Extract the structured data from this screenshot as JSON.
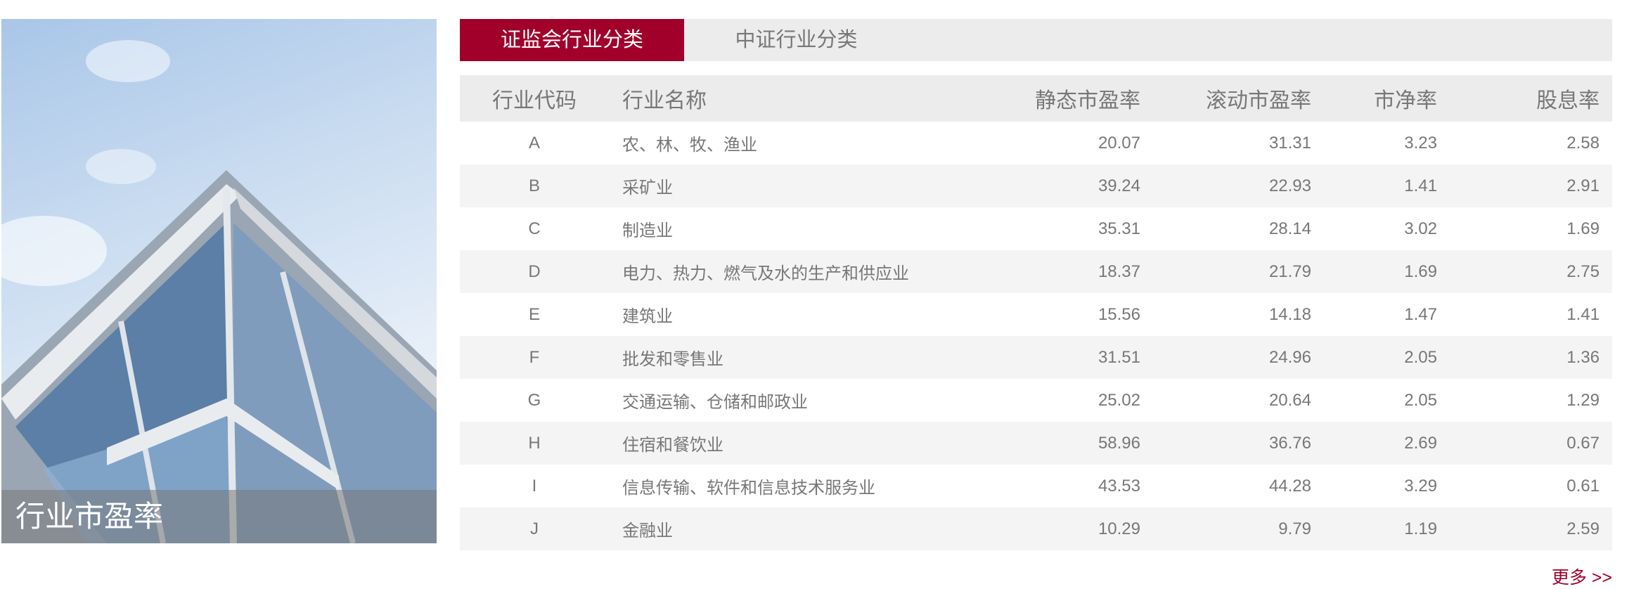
{
  "hero": {
    "caption": "行业市盈率"
  },
  "tabs": [
    {
      "label": "证监会行业分类",
      "active": true
    },
    {
      "label": "中证行业分类",
      "active": false
    }
  ],
  "table": {
    "headers": [
      "行业代码",
      "行业名称",
      "静态市盈率",
      "滚动市盈率",
      "市净率",
      "股息率"
    ],
    "rows": [
      [
        "A",
        "农、林、牧、渔业",
        "20.07",
        "31.31",
        "3.23",
        "2.58"
      ],
      [
        "B",
        "采矿业",
        "39.24",
        "22.93",
        "1.41",
        "2.91"
      ],
      [
        "C",
        "制造业",
        "35.31",
        "28.14",
        "3.02",
        "1.69"
      ],
      [
        "D",
        "电力、热力、燃气及水的生产和供应业",
        "18.37",
        "21.79",
        "1.69",
        "2.75"
      ],
      [
        "E",
        "建筑业",
        "15.56",
        "14.18",
        "1.47",
        "1.41"
      ],
      [
        "F",
        "批发和零售业",
        "31.51",
        "24.96",
        "2.05",
        "1.36"
      ],
      [
        "G",
        "交通运输、仓储和邮政业",
        "25.02",
        "20.64",
        "2.05",
        "1.29"
      ],
      [
        "H",
        "住宿和餐饮业",
        "58.96",
        "36.76",
        "2.69",
        "0.67"
      ],
      [
        "I",
        "信息传输、软件和信息技术服务业",
        "43.53",
        "44.28",
        "3.29",
        "0.61"
      ],
      [
        "J",
        "金融业",
        "10.29",
        "9.79",
        "1.19",
        "2.59"
      ]
    ]
  },
  "more_link": "更多 >>",
  "colors": {
    "accent": "#a0002a",
    "header_bg": "#ececec",
    "alt_row": "#f4f4f4"
  }
}
